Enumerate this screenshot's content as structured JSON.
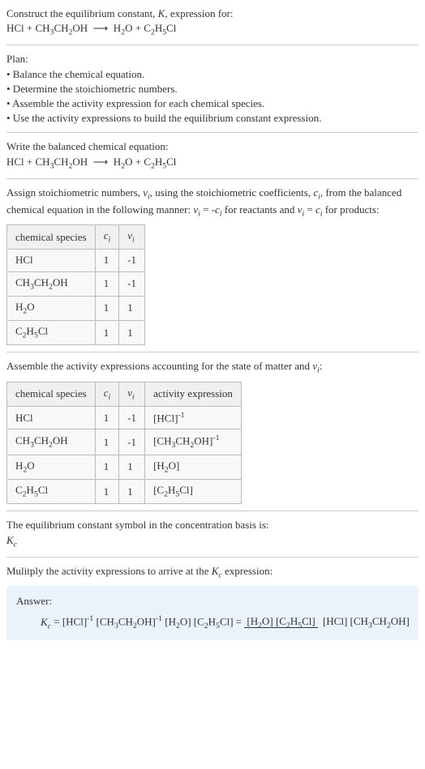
{
  "header": {
    "line1": "Construct the equilibrium constant, K, expression for:",
    "equation": "HCl + CH₃CH₂OH  ⟶  H₂O + C₂H₅Cl"
  },
  "plan": {
    "title": "Plan:",
    "items": [
      "• Balance the chemical equation.",
      "• Determine the stoichiometric numbers.",
      "• Assemble the activity expression for each chemical species.",
      "• Use the activity expressions to build the equilibrium constant expression."
    ]
  },
  "balanced": {
    "title": "Write the balanced chemical equation:",
    "equation": "HCl + CH₃CH₂OH  ⟶  H₂O + C₂H₅Cl"
  },
  "stoich": {
    "intro1": "Assign stoichiometric numbers, νᵢ, using the stoichiometric coefficients, cᵢ, from the balanced chemical equation in the following manner: νᵢ = -cᵢ for reactants and νᵢ = cᵢ for products:",
    "table": {
      "headers": [
        "chemical species",
        "cᵢ",
        "νᵢ"
      ],
      "rows": [
        [
          "HCl",
          "1",
          "-1"
        ],
        [
          "CH₃CH₂OH",
          "1",
          "-1"
        ],
        [
          "H₂O",
          "1",
          "1"
        ],
        [
          "C₂H₅Cl",
          "1",
          "1"
        ]
      ]
    }
  },
  "activity": {
    "intro": "Assemble the activity expressions accounting for the state of matter and νᵢ:",
    "table": {
      "headers": [
        "chemical species",
        "cᵢ",
        "νᵢ",
        "activity expression"
      ],
      "rows": [
        {
          "species": "HCl",
          "c": "1",
          "v": "-1",
          "expr": "[HCl]⁻¹"
        },
        {
          "species": "CH₃CH₂OH",
          "c": "1",
          "v": "-1",
          "expr": "[CH₃CH₂OH]⁻¹"
        },
        {
          "species": "H₂O",
          "c": "1",
          "v": "1",
          "expr": "[H₂O]"
        },
        {
          "species": "C₂H₅Cl",
          "c": "1",
          "v": "1",
          "expr": "[C₂H₅Cl]"
        }
      ]
    }
  },
  "basis": {
    "line1": "The equilibrium constant symbol in the concentration basis is:",
    "symbol": "K_c"
  },
  "multiply": {
    "line": "Mulitply the activity expressions to arrive at the K_c expression:"
  },
  "answer": {
    "label": "Answer:",
    "lhs": "K_c = [HCl]⁻¹ [CH₃CH₂OH]⁻¹ [H₂O] [C₂H₅Cl] =",
    "frac_num": "[H₂O] [C₂H₅Cl]",
    "frac_den": "[HCl] [CH₃CH₂OH]"
  },
  "chart_data": {
    "type": "table",
    "tables": [
      {
        "title": "Stoichiometric numbers",
        "columns": [
          "chemical species",
          "c_i",
          "ν_i"
        ],
        "rows": [
          [
            "HCl",
            1,
            -1
          ],
          [
            "CH3CH2OH",
            1,
            -1
          ],
          [
            "H2O",
            1,
            1
          ],
          [
            "C2H5Cl",
            1,
            1
          ]
        ]
      },
      {
        "title": "Activity expressions",
        "columns": [
          "chemical species",
          "c_i",
          "ν_i",
          "activity expression"
        ],
        "rows": [
          [
            "HCl",
            1,
            -1,
            "[HCl]^-1"
          ],
          [
            "CH3CH2OH",
            1,
            -1,
            "[CH3CH2OH]^-1"
          ],
          [
            "H2O",
            1,
            1,
            "[H2O]"
          ],
          [
            "C2H5Cl",
            1,
            1,
            "[C2H5Cl]"
          ]
        ]
      }
    ]
  }
}
